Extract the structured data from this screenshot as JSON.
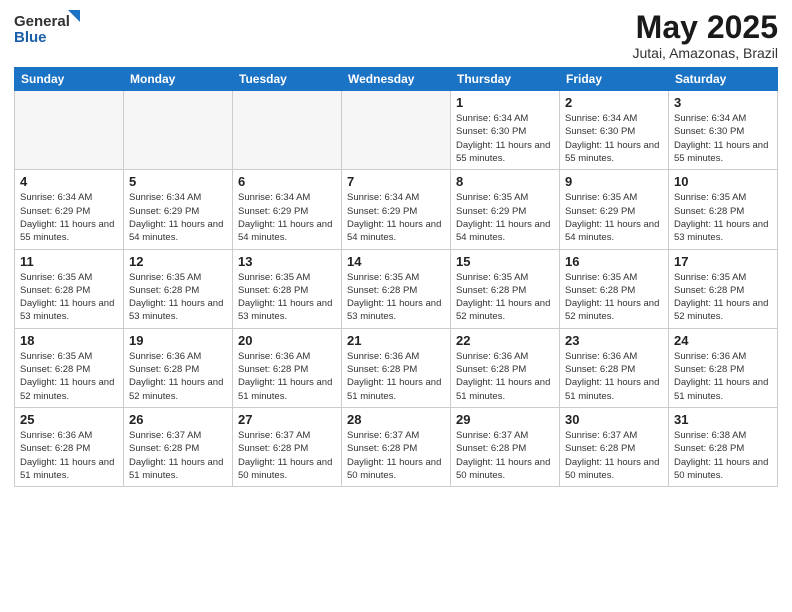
{
  "header": {
    "logo_general": "General",
    "logo_blue": "Blue",
    "month_title": "May 2025",
    "location": "Jutai, Amazonas, Brazil"
  },
  "days_of_week": [
    "Sunday",
    "Monday",
    "Tuesday",
    "Wednesday",
    "Thursday",
    "Friday",
    "Saturday"
  ],
  "weeks": [
    [
      {
        "day": "",
        "detail": ""
      },
      {
        "day": "",
        "detail": ""
      },
      {
        "day": "",
        "detail": ""
      },
      {
        "day": "",
        "detail": ""
      },
      {
        "day": "1",
        "detail": "Sunrise: 6:34 AM\nSunset: 6:30 PM\nDaylight: 11 hours\nand 55 minutes."
      },
      {
        "day": "2",
        "detail": "Sunrise: 6:34 AM\nSunset: 6:30 PM\nDaylight: 11 hours\nand 55 minutes."
      },
      {
        "day": "3",
        "detail": "Sunrise: 6:34 AM\nSunset: 6:30 PM\nDaylight: 11 hours\nand 55 minutes."
      }
    ],
    [
      {
        "day": "4",
        "detail": "Sunrise: 6:34 AM\nSunset: 6:29 PM\nDaylight: 11 hours\nand 55 minutes."
      },
      {
        "day": "5",
        "detail": "Sunrise: 6:34 AM\nSunset: 6:29 PM\nDaylight: 11 hours\nand 54 minutes."
      },
      {
        "day": "6",
        "detail": "Sunrise: 6:34 AM\nSunset: 6:29 PM\nDaylight: 11 hours\nand 54 minutes."
      },
      {
        "day": "7",
        "detail": "Sunrise: 6:34 AM\nSunset: 6:29 PM\nDaylight: 11 hours\nand 54 minutes."
      },
      {
        "day": "8",
        "detail": "Sunrise: 6:35 AM\nSunset: 6:29 PM\nDaylight: 11 hours\nand 54 minutes."
      },
      {
        "day": "9",
        "detail": "Sunrise: 6:35 AM\nSunset: 6:29 PM\nDaylight: 11 hours\nand 54 minutes."
      },
      {
        "day": "10",
        "detail": "Sunrise: 6:35 AM\nSunset: 6:28 PM\nDaylight: 11 hours\nand 53 minutes."
      }
    ],
    [
      {
        "day": "11",
        "detail": "Sunrise: 6:35 AM\nSunset: 6:28 PM\nDaylight: 11 hours\nand 53 minutes."
      },
      {
        "day": "12",
        "detail": "Sunrise: 6:35 AM\nSunset: 6:28 PM\nDaylight: 11 hours\nand 53 minutes."
      },
      {
        "day": "13",
        "detail": "Sunrise: 6:35 AM\nSunset: 6:28 PM\nDaylight: 11 hours\nand 53 minutes."
      },
      {
        "day": "14",
        "detail": "Sunrise: 6:35 AM\nSunset: 6:28 PM\nDaylight: 11 hours\nand 53 minutes."
      },
      {
        "day": "15",
        "detail": "Sunrise: 6:35 AM\nSunset: 6:28 PM\nDaylight: 11 hours\nand 52 minutes."
      },
      {
        "day": "16",
        "detail": "Sunrise: 6:35 AM\nSunset: 6:28 PM\nDaylight: 11 hours\nand 52 minutes."
      },
      {
        "day": "17",
        "detail": "Sunrise: 6:35 AM\nSunset: 6:28 PM\nDaylight: 11 hours\nand 52 minutes."
      }
    ],
    [
      {
        "day": "18",
        "detail": "Sunrise: 6:35 AM\nSunset: 6:28 PM\nDaylight: 11 hours\nand 52 minutes."
      },
      {
        "day": "19",
        "detail": "Sunrise: 6:36 AM\nSunset: 6:28 PM\nDaylight: 11 hours\nand 52 minutes."
      },
      {
        "day": "20",
        "detail": "Sunrise: 6:36 AM\nSunset: 6:28 PM\nDaylight: 11 hours\nand 51 minutes."
      },
      {
        "day": "21",
        "detail": "Sunrise: 6:36 AM\nSunset: 6:28 PM\nDaylight: 11 hours\nand 51 minutes."
      },
      {
        "day": "22",
        "detail": "Sunrise: 6:36 AM\nSunset: 6:28 PM\nDaylight: 11 hours\nand 51 minutes."
      },
      {
        "day": "23",
        "detail": "Sunrise: 6:36 AM\nSunset: 6:28 PM\nDaylight: 11 hours\nand 51 minutes."
      },
      {
        "day": "24",
        "detail": "Sunrise: 6:36 AM\nSunset: 6:28 PM\nDaylight: 11 hours\nand 51 minutes."
      }
    ],
    [
      {
        "day": "25",
        "detail": "Sunrise: 6:36 AM\nSunset: 6:28 PM\nDaylight: 11 hours\nand 51 minutes."
      },
      {
        "day": "26",
        "detail": "Sunrise: 6:37 AM\nSunset: 6:28 PM\nDaylight: 11 hours\nand 51 minutes."
      },
      {
        "day": "27",
        "detail": "Sunrise: 6:37 AM\nSunset: 6:28 PM\nDaylight: 11 hours\nand 50 minutes."
      },
      {
        "day": "28",
        "detail": "Sunrise: 6:37 AM\nSunset: 6:28 PM\nDaylight: 11 hours\nand 50 minutes."
      },
      {
        "day": "29",
        "detail": "Sunrise: 6:37 AM\nSunset: 6:28 PM\nDaylight: 11 hours\nand 50 minutes."
      },
      {
        "day": "30",
        "detail": "Sunrise: 6:37 AM\nSunset: 6:28 PM\nDaylight: 11 hours\nand 50 minutes."
      },
      {
        "day": "31",
        "detail": "Sunrise: 6:38 AM\nSunset: 6:28 PM\nDaylight: 11 hours\nand 50 minutes."
      }
    ]
  ]
}
